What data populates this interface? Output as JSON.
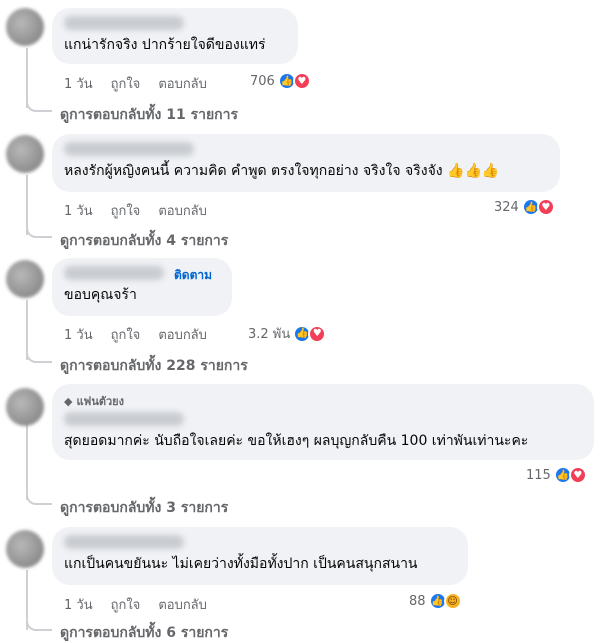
{
  "comments": [
    {
      "text": "แกน่ารักจริง ปากร้ายใจดีของแทร่",
      "time": "1 วัน",
      "like_label": "ถูกใจ",
      "reply_label": "ตอบกลับ",
      "reaction_count": "706",
      "replies_link": "ดูการตอบกลับทั้ง 11 รายการ"
    },
    {
      "text": "หลงรักผู้หญิงคนนี้ ความคิด คำพูด ตรงใจทุกอย่าง จริงใจ จริงจัง 👍👍👍",
      "time": "1 วัน",
      "like_label": "ถูกใจ",
      "reply_label": "ตอบกลับ",
      "reaction_count": "324",
      "replies_link": "ดูการตอบกลับทั้ง 4 รายการ"
    },
    {
      "text": "ขอบคุณจร้า",
      "follow_label": "ติดตาม",
      "time": "1 วัน",
      "like_label": "ถูกใจ",
      "reply_label": "ตอบกลับ",
      "reaction_count": "3.2 พัน",
      "replies_link": "ดูการตอบกลับทั้ง 228 รายการ"
    },
    {
      "badge": "แฟนตัวยง",
      "text": "สุดยอดมากค่ะ นับถือใจเลยค่ะ ขอให้เฮงๆ ผลบุญกลับคืน 100 เท่าพันเท่านะคะ",
      "reaction_count": "115",
      "replies_link": "ดูการตอบกลับทั้ง 3 รายการ"
    },
    {
      "text": "แกเป็นคนขยันนะ ไม่เคยว่างทั้งมือทั้งปาก เป็นคนสนุกสนาน",
      "time": "1 วัน",
      "like_label": "ถูกใจ",
      "reply_label": "ตอบกลับ",
      "reaction_count": "88",
      "replies_link": "ดูการตอบกลับทั้ง 6 รายการ"
    }
  ],
  "colors": {
    "bubble": "#f0f2f5",
    "like": "#1877f2",
    "love": "#f33e58",
    "follow": "#0064d1"
  }
}
